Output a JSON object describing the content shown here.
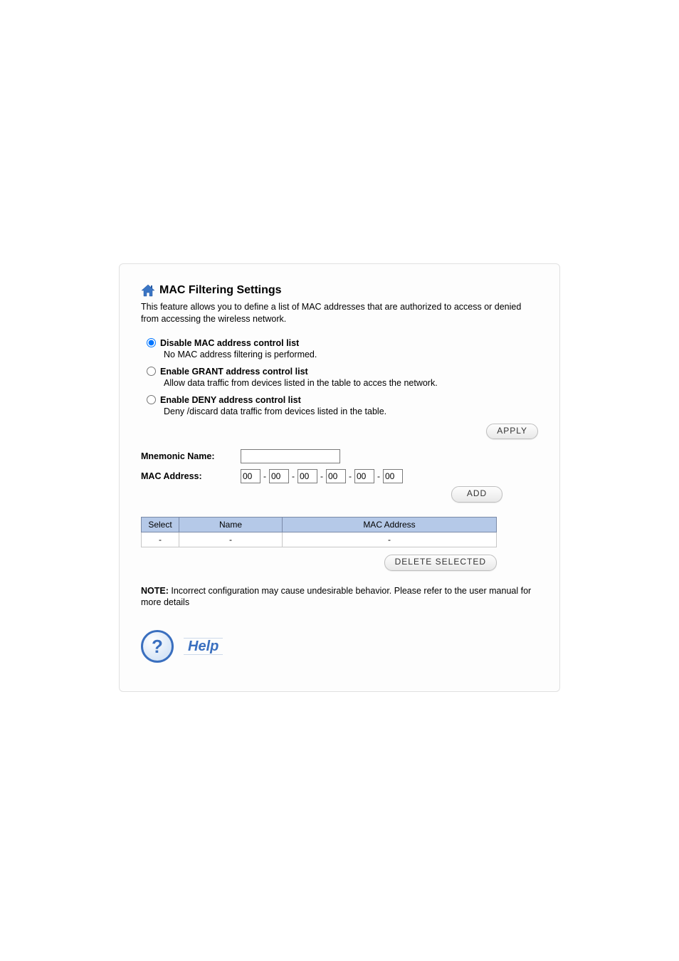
{
  "header": {
    "title": "MAC Filtering Settings",
    "intro": "This feature allows you to define a list of MAC addresses that are authorized to access or denied from accessing the wireless network."
  },
  "options": {
    "selected": "disable",
    "disable": {
      "label": "Disable MAC address control list",
      "desc": "No MAC address filtering is performed."
    },
    "grant": {
      "label": "Enable GRANT address control list",
      "desc": "Allow data traffic from devices listed in the table to acces the network."
    },
    "deny": {
      "label": "Enable DENY address control list",
      "desc": "Deny /discard data traffic from devices listed in the table."
    }
  },
  "buttons": {
    "apply": "APPLY",
    "add": "ADD",
    "delete": "DELETE SELECTED"
  },
  "form": {
    "mnemonic_label": "Mnemonic Name:",
    "mnemonic_value": "",
    "mac_label": "MAC Address:",
    "mac": [
      "00",
      "00",
      "00",
      "00",
      "00",
      "00"
    ]
  },
  "table": {
    "headers": {
      "select": "Select",
      "name": "Name",
      "mac": "MAC Address"
    },
    "rows": [
      {
        "select": "-",
        "name": "-",
        "mac": "-"
      }
    ]
  },
  "note": {
    "label": "NOTE:",
    "text": " Incorrect configuration may cause undesirable behavior. Please refer to the user manual for more details"
  },
  "help": {
    "label": "Help"
  }
}
